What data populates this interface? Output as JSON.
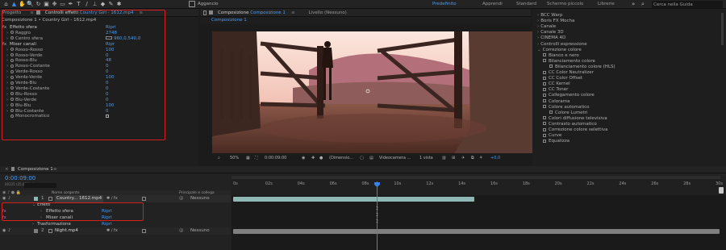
{
  "toolbar": {
    "tools": [
      {
        "icon": "home-icon",
        "glyph": "⌂"
      },
      {
        "icon": "selection-tool-icon",
        "glyph": "▲"
      },
      {
        "icon": "hand-tool-icon",
        "glyph": "✋"
      },
      {
        "icon": "zoom-tool-icon",
        "glyph": "🔍"
      },
      {
        "icon": "rotate-tool-icon",
        "glyph": "↻"
      },
      {
        "icon": "camera-tool-icon",
        "glyph": "▣"
      },
      {
        "icon": "pan-behind-tool-icon",
        "glyph": "✥"
      },
      {
        "icon": "rectangle-tool-icon",
        "glyph": "▭"
      },
      {
        "icon": "pen-tool-icon",
        "glyph": "✒"
      },
      {
        "icon": "type-tool-icon",
        "glyph": "T"
      },
      {
        "icon": "brush-tool-icon",
        "glyph": "/"
      },
      {
        "icon": "clone-stamp-tool-icon",
        "glyph": "⊥"
      },
      {
        "icon": "eraser-tool-icon",
        "glyph": "◆"
      },
      {
        "icon": "roto-brush-tool-icon",
        "glyph": "✎"
      },
      {
        "icon": "puppet-tool-icon",
        "glyph": "✱"
      }
    ],
    "snapping_label": "Aggancio",
    "workspaces": [
      "Predefinito",
      "Apprendi",
      "Standard",
      "Schermo piccolo",
      "Librerie"
    ],
    "active_workspace": "Predefinito",
    "search_placeholder": "Cerca nella Guida"
  },
  "project_panel": {
    "tab_project": "Progetto",
    "tab_effect_controls_prefix": "Controlli effetti",
    "tab_effect_controls_item": "Country Girl - 1612.mp4",
    "header_path": "Composizione 1 • Country Girl - 1612.mp4",
    "effect_1": {
      "name": "Effetto sfera",
      "reset": "Ripri",
      "props": [
        {
          "name": "Raggio",
          "value": "2748"
        },
        {
          "name": "Centro sfera",
          "value": "960,0,540,0"
        }
      ]
    },
    "effect_2": {
      "name": "Mixer canali",
      "reset": "Ripr",
      "props": [
        {
          "name": "Rosso-Rosso",
          "value": "100"
        },
        {
          "name": "Rosso-Verde",
          "value": "0"
        },
        {
          "name": "Rosso-Blu",
          "value": "48"
        },
        {
          "name": "Rosso-Costante",
          "value": "0"
        },
        {
          "name": "Verde-Rosso",
          "value": "0"
        },
        {
          "name": "Verde-Verde",
          "value": "100"
        },
        {
          "name": "Verde-Blu",
          "value": "0"
        },
        {
          "name": "Verde-Costante",
          "value": "0"
        },
        {
          "name": "Blu-Rosso",
          "value": "0"
        },
        {
          "name": "Blu-Verde",
          "value": "0"
        },
        {
          "name": "Blu-Blu",
          "value": "100"
        },
        {
          "name": "Blu-Costante",
          "value": "0"
        }
      ]
    },
    "monochrome_label": "Monocromatico"
  },
  "composition_panel": {
    "tab_prefix": "Composizione",
    "tab_name": "Composizione 1",
    "layer_label": "Livello",
    "layer_value": "(Nessuno)",
    "breadcrumb": "Composizione 1",
    "footer": {
      "zoom": "50%",
      "timecode": "0:00:09:00",
      "resolution": "(Dimensio...",
      "camera": "Videocamera ...",
      "views": "1 vista",
      "exposure": "+0,0"
    }
  },
  "effects_panel": {
    "top_items": [
      "BCC Warp",
      "Boris FX Mocha",
      "Canale",
      "Canale 3D",
      "CINEMA 4D",
      "Controlli espressione"
    ],
    "expanded_category": "Correzione colore",
    "items": [
      "Bianco e nero",
      "Bilanciamento colore",
      "Bilanciamento colore (HLS)",
      "CC Color Neutralizer",
      "CC Color Offset",
      "CC Kernel",
      "CC Toner",
      "Collegamento colore",
      "Colorama",
      "Colore automatico",
      "Colore Lumetri",
      "Colori diffusione televisiva",
      "Contrasto automatico",
      "Correzione colore selettiva",
      "Curve",
      "Equalizza"
    ]
  },
  "timeline": {
    "comp_tab": "Composizione 1",
    "timecode": "0:00:09:00",
    "fps_note": "00225 (25,00 fps)",
    "col_layer_name": "Nome sorgente",
    "col_parent": "Principale e collega",
    "ruler_ticks": [
      "0s",
      "02s",
      "04s",
      "06s",
      "08s",
      "10s",
      "12s",
      "14s",
      "16s",
      "18s",
      "20s",
      "22s",
      "24s",
      "26s",
      "28s",
      "30s"
    ],
    "layers": [
      {
        "index": "1",
        "name": "Country... 1612.mp4",
        "parent": "Nessuno"
      },
      {
        "index": "2",
        "name": "Night.mp4",
        "parent": "Nessuno"
      }
    ],
    "effects_group": "Effetti",
    "effect_rows": [
      {
        "name": "Effetto sfera",
        "reset": "Ripri"
      },
      {
        "name": "Mixer canali",
        "reset": "Ripri"
      }
    ],
    "transform_label": "Trasformazione",
    "transform_reset": "Ripri"
  }
}
